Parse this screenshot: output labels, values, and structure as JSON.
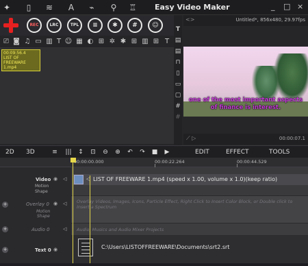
{
  "app": {
    "title": "Easy Video Maker"
  },
  "top_icons": [
    "magic-wand-icon",
    "book-icon",
    "layers-icon",
    "text-a-icon",
    "brush-icon",
    "search-icon",
    "tshirt-icon"
  ],
  "window_controls": {
    "minimize": "_",
    "restore": "□",
    "close": "×"
  },
  "toolbar": {
    "buttons": [
      {
        "name": "rec-button",
        "label": "REC"
      },
      {
        "name": "lrc-button",
        "label": "LRC"
      },
      {
        "name": "tpl-button",
        "label": "TPL"
      }
    ]
  },
  "toolbar2_glyphs": [
    "⎚",
    "◙",
    "♫",
    "▭",
    "▥",
    "T",
    "☺",
    "▦",
    "◐",
    "⊞",
    "✲",
    "✱",
    "⊞",
    "▥",
    "⊞",
    "T"
  ],
  "media": {
    "clip": {
      "time": "00:09:56.4",
      "title": "LIST OF FREEWARE 1.mp4"
    }
  },
  "vertical_tools": [
    "T",
    "▤",
    "▤",
    "⊓",
    "▯",
    "▭",
    "▢",
    "#",
    "#"
  ],
  "preview": {
    "header": "Untitled*, 856x480, 29.97fps",
    "subtitle_line1": "one of the most important aspects",
    "subtitle_line2": "of finance is interest.",
    "time": "00:00:07.1"
  },
  "tabs": {
    "mode_2d": "2D",
    "mode_3d": "3D",
    "edit": "EDIT",
    "effect": "EFFECT",
    "tools": "TOOLS"
  },
  "timeline_tools": [
    "≡",
    "|||",
    "↕",
    "⊡",
    "⊖",
    "⊕",
    "↶",
    "↷",
    "■",
    "▶"
  ],
  "ruler": {
    "marks": [
      "00:00:00.000",
      "00:00:22.264",
      "00:00:44.529"
    ]
  },
  "tracks": {
    "video": {
      "label": "Video",
      "motion": "Motion",
      "shape": "Shape",
      "clip_text": "LIST OF FREEWARE 1.mp4   (speed x 1.00, volume x 1.0)(keep ratio)"
    },
    "overlay": {
      "label": "Overlay 0",
      "motion": "Motion",
      "shape": "Shape",
      "hint": "Overlay Videos, Images, Icons, Particle Effect, Right Click to Insert Color Block, or Double click to Insert a Spectrum"
    },
    "audio": {
      "label": "Audio 0",
      "hint": "Audio, Musics and Audio Mixer Projects"
    },
    "text": {
      "label": "Text 0",
      "path": "C:\\Users\\LISTOFFREEWARE\\Documents\\srt2.srt"
    }
  }
}
